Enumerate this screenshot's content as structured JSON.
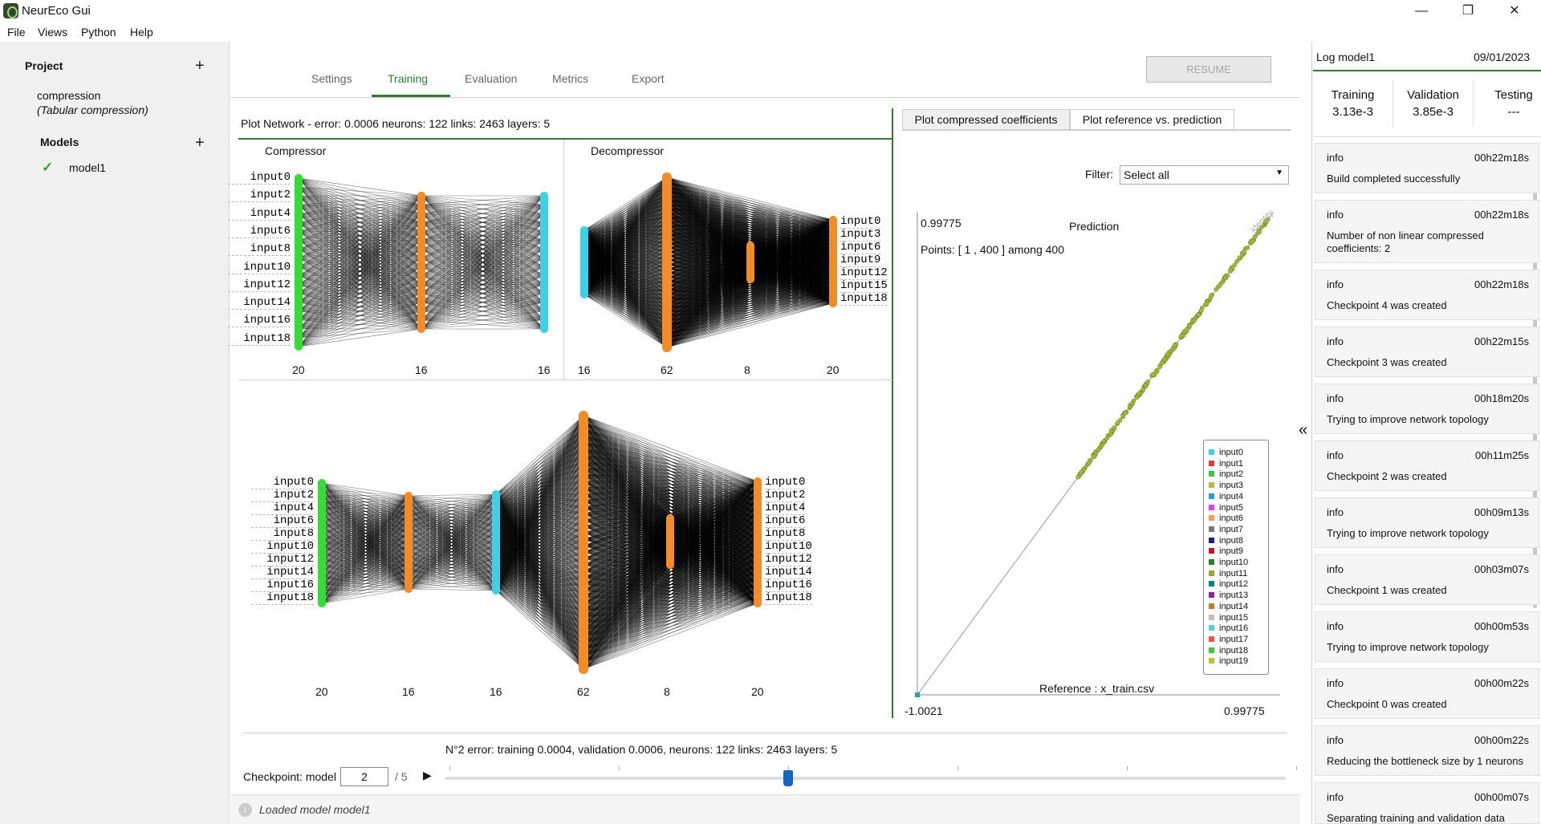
{
  "window": {
    "title": "NeurEco Gui",
    "minimize": "—",
    "maximize": "❐",
    "close": "✕"
  },
  "menu": [
    "File",
    "Views",
    "Python",
    "Help"
  ],
  "project": {
    "heading": "Project",
    "name": "compression",
    "type": "(Tabular compression)",
    "models_heading": "Models",
    "models": [
      {
        "name": "model1",
        "check": "✓"
      }
    ]
  },
  "tabs": [
    "Settings",
    "Training",
    "Evaluation",
    "Metrics",
    "Export"
  ],
  "active_tab": "Training",
  "resume_label": "RESUME",
  "plot_network": {
    "header": "Plot Network -  error: 0.0006  neurons: 122  links: 2463  layers: 5",
    "compressor": {
      "title": "Compressor",
      "labels": [
        "input0",
        "input2",
        "input4",
        "input6",
        "input8",
        "input10",
        "input12",
        "input14",
        "input16",
        "input18"
      ],
      "counts": [
        "20",
        "16",
        "16"
      ]
    },
    "decompressor": {
      "title": "Decompressor",
      "labels": [
        "input0",
        "input3",
        "input6",
        "input9",
        "input12",
        "input15",
        "input18"
      ],
      "counts": [
        "16",
        "62",
        "8",
        "20"
      ]
    },
    "full": {
      "left_labels": [
        "input0",
        "input2",
        "input4",
        "input6",
        "input8",
        "input10",
        "input12",
        "input14",
        "input16",
        "input18"
      ],
      "right_labels": [
        "input0",
        "input2",
        "input4",
        "input6",
        "input8",
        "input10",
        "input12",
        "input14",
        "input16",
        "input18"
      ],
      "counts": [
        "20",
        "16",
        "16",
        "62",
        "8",
        "20"
      ]
    },
    "colors": {
      "input_layer": "#33dd33",
      "hidden": "#f28c28",
      "bottleneck": "#3ed0e8",
      "links": "#000000"
    }
  },
  "plot_tabs": [
    "Plot compressed coefficients",
    "Plot reference vs. prediction"
  ],
  "filter": {
    "label": "Filter:",
    "value": "Select all"
  },
  "scatter": {
    "top_value": "0.99775",
    "title": "Prediction",
    "points_text": "Points: [ 1 , 400 ] among 400",
    "xlabel": "Reference : x_train.csv",
    "xmin_label": "-1.0021",
    "xmax_label": "0.99775",
    "identity_label": "identity"
  },
  "chart_data": {
    "type": "scatter",
    "title": "Prediction",
    "xlabel": "Reference : x_train.csv",
    "ylabel": "",
    "xlim": [
      -1.0021,
      0.99775
    ],
    "ylim": [
      -1.0021,
      0.99775
    ],
    "series_color": "#a4b83a",
    "legend": [
      "input0",
      "input1",
      "input2",
      "input3",
      "input4",
      "input5",
      "input6",
      "input7",
      "input8",
      "input9",
      "input10",
      "input11",
      "input12",
      "input13",
      "input14",
      "input15",
      "input16",
      "input17",
      "input18",
      "input19"
    ],
    "legend_colors": [
      "#3ed0e8",
      "#e53935",
      "#43c343",
      "#b5bd3a",
      "#3399dd",
      "#e040e0",
      "#f0a050",
      "#7a7a7a",
      "#1a237e",
      "#b71c1c",
      "#2e7d32",
      "#9aa62a",
      "#00838f",
      "#8e24aa",
      "#c07a3a",
      "#c0c0c0",
      "#4dd0e1",
      "#ef5350",
      "#43c343",
      "#c0c030"
    ],
    "legend_position": "lower-right"
  },
  "bottom": {
    "summary": "N°2 error: training 0.0004, validation 0.0006,   neurons: 122  links: 2463  layers: 5",
    "checkpoint_label": "Checkpoint: model",
    "checkpoint_value": "2",
    "checkpoint_total": "/ 5",
    "play": "▶",
    "slider_position": 0.4,
    "status": "Loaded model model1",
    "status_icon": "i"
  },
  "log": {
    "title": "Log model1",
    "date": "09/01/2023",
    "stats": [
      {
        "label": "Training",
        "value": "3.13e-3"
      },
      {
        "label": "Validation",
        "value": "3.85e-3"
      },
      {
        "label": "Testing",
        "value": "---"
      }
    ],
    "collapse": "«",
    "entries": [
      {
        "level": "info",
        "time": "00h22m18s",
        "message": "Build completed successfully"
      },
      {
        "level": "info",
        "time": "00h22m18s",
        "message": "Number of non linear compressed coefficients: 2"
      },
      {
        "level": "info",
        "time": "00h22m18s",
        "message": "Checkpoint 4 was created"
      },
      {
        "level": "info",
        "time": "00h22m15s",
        "message": "Checkpoint 3 was created"
      },
      {
        "level": "info",
        "time": "00h18m20s",
        "message": "Trying to improve network topology"
      },
      {
        "level": "info",
        "time": "00h11m25s",
        "message": "Checkpoint 2 was created"
      },
      {
        "level": "info",
        "time": "00h09m13s",
        "message": "Trying to improve network topology"
      },
      {
        "level": "info",
        "time": "00h03m07s",
        "message": "Checkpoint 1 was created"
      },
      {
        "level": "info",
        "time": "00h00m53s",
        "message": "Trying to improve network topology"
      },
      {
        "level": "info",
        "time": "00h00m22s",
        "message": "Checkpoint 0 was created"
      },
      {
        "level": "info",
        "time": "00h00m22s",
        "message": "Reducing the bottleneck size by 1 neurons"
      },
      {
        "level": "info",
        "time": "00h00m07s",
        "message": "Separating training and validation data"
      }
    ]
  }
}
